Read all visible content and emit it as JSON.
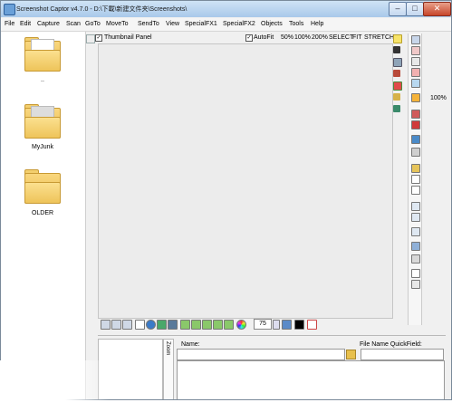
{
  "window": {
    "title": "Screenshot Captor v4.7.0 - D:\\下載\\新建文件夹\\Screenshots\\"
  },
  "menu": [
    "File",
    "Edit",
    "Capture",
    "Scan",
    "GoTo",
    "MoveTo",
    "SendTo",
    "View",
    "SpecialFX1",
    "SpecialFX2",
    "Objects",
    "Tools",
    "Help"
  ],
  "folders": [
    {
      "label": ".."
    },
    {
      "label": "MyJunk"
    },
    {
      "label": "OLDER"
    }
  ],
  "thumbnail_panel": {
    "label": "Thumbnail Panel",
    "checked": true
  },
  "zoom_bar": {
    "autofit_label": "AutoFit",
    "autofit_checked": true,
    "options": [
      "50%",
      "100%",
      "200%",
      "SELECT",
      "FIT",
      "STRETCH"
    ]
  },
  "zoom_level_label": "100%",
  "bottom_toolbar": {
    "zoom_value": "75"
  },
  "bottom_panel": {
    "zoom_tab_label": "Zoom",
    "name_label": "Name:",
    "quickfield_label": "File Name QuickField:"
  },
  "colors": {
    "accent": "#a9c9ea",
    "folder": "#eec45a",
    "background": "#ececec"
  }
}
